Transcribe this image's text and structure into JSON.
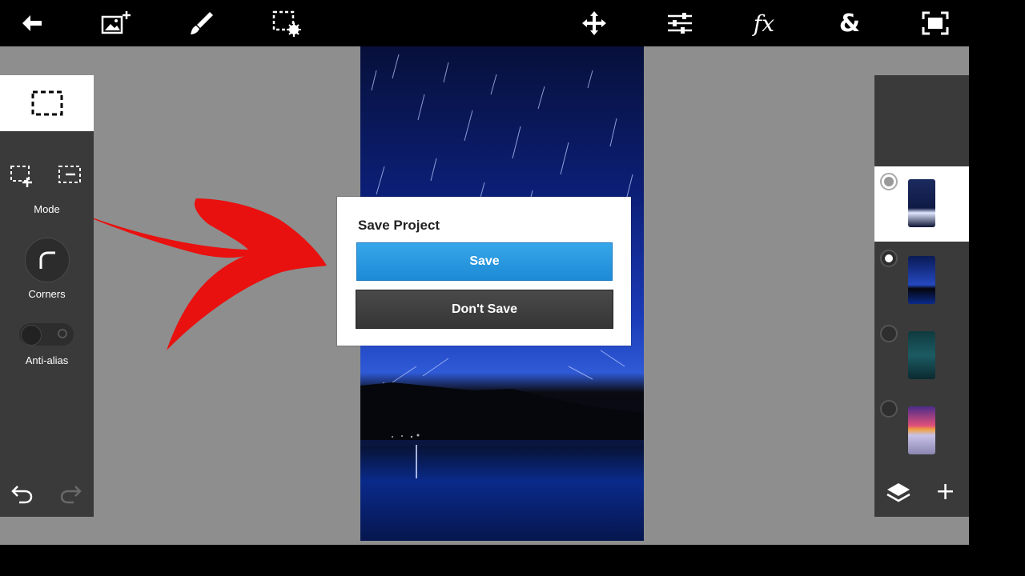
{
  "toolbar": {
    "icons": [
      "back-arrow-icon",
      "add-image-icon",
      "brush-icon",
      "selection-settings-icon",
      "move-icon",
      "adjustments-icon",
      "fx-icon",
      "blend-icon",
      "fit-screen-icon"
    ],
    "fx_label": "fx",
    "blend_label": "&"
  },
  "left_panel": {
    "mode_label": "Mode",
    "corners_label": "Corners",
    "antialias_label": "Anti-alias",
    "antialias_on": false
  },
  "dialog": {
    "title": "Save Project",
    "save_label": "Save",
    "dont_save_label": "Don't Save"
  },
  "layers": {
    "count": 4,
    "selected_index": 1,
    "plus_label": "+"
  },
  "colors": {
    "accent": "#1d8ad6",
    "panel": "#3a3a3a",
    "canvas_bg": "#8e8e8e",
    "annotation_arrow": "#e8110f"
  }
}
